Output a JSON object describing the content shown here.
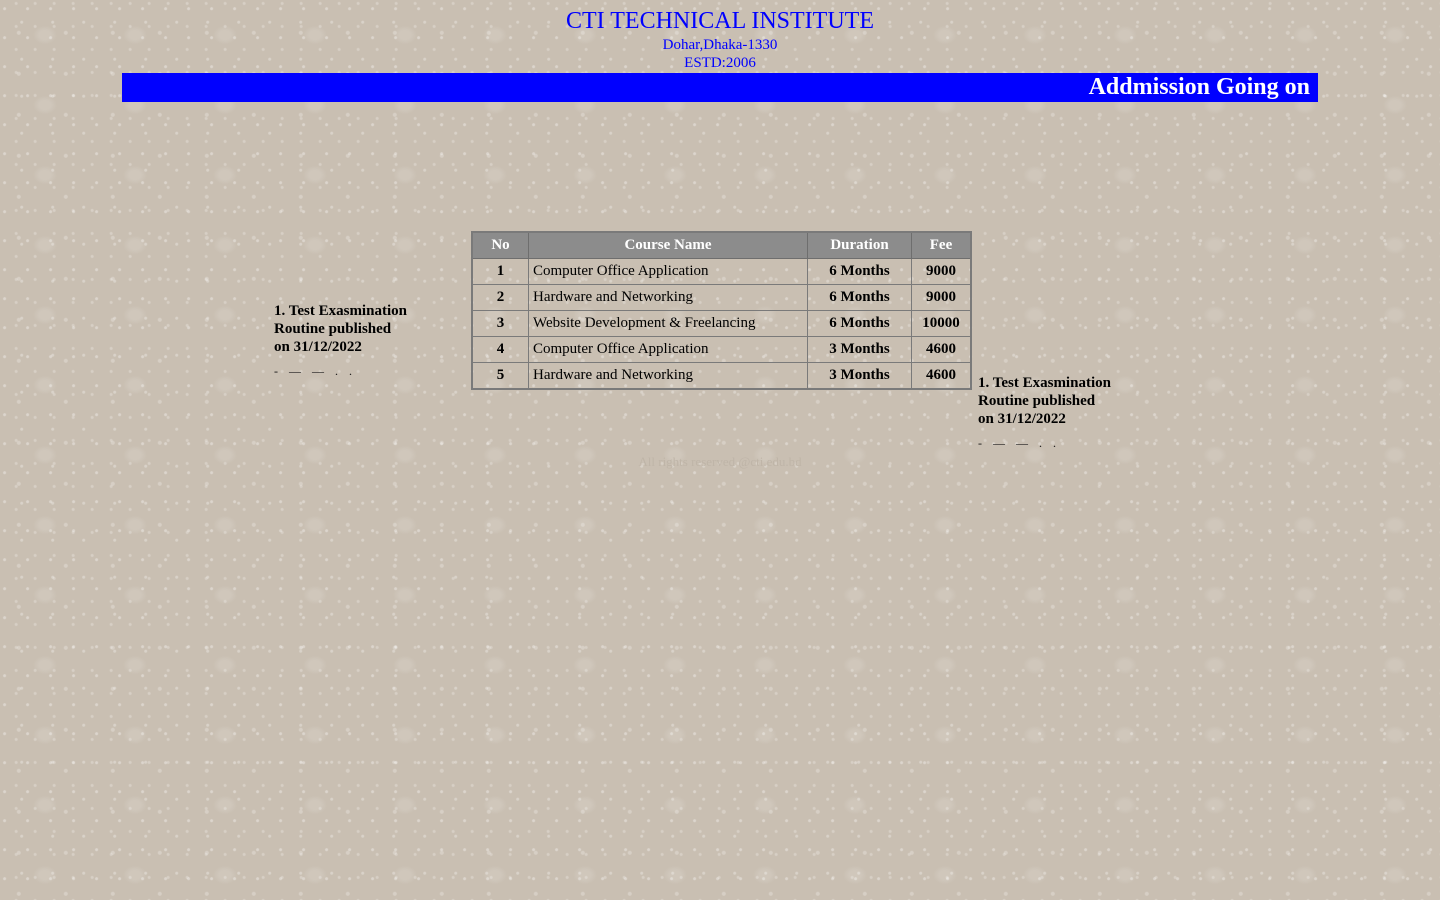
{
  "header": {
    "title": "CTI TECHNICAL INSTITUTE",
    "address": "Dohar,Dhaka-1330",
    "established": "ESTD:2006"
  },
  "marquee": {
    "text": "Addmission Going on",
    "background_color": "#0000ff",
    "text_color": "#ffffff"
  },
  "notices": {
    "left": {
      "line1": "1. Test Exasmination",
      "line2": "Routine published",
      "line3": "on 31/12/2022",
      "dashes": "- — — . ."
    },
    "right": {
      "line1": "1. Test Exasmination",
      "line2": "Routine published",
      "line3": "on 31/12/2022",
      "dashes": "- — — . ."
    }
  },
  "courses": {
    "headers": {
      "no": "No",
      "name": "Course Name",
      "duration": "Duration",
      "fee": "Fee"
    },
    "rows": [
      {
        "no": "1",
        "name": "Computer Office Application",
        "duration": "6 Months",
        "fee": "9000"
      },
      {
        "no": "2",
        "name": "Hardware and Networking",
        "duration": "6 Months",
        "fee": "9000"
      },
      {
        "no": "3",
        "name": "Website Development & Freelancing",
        "duration": "6 Months",
        "fee": "10000"
      },
      {
        "no": "4",
        "name": "Computer Office Application",
        "duration": "3 Months",
        "fee": "4600"
      },
      {
        "no": "5",
        "name": "Hardware and Networking",
        "duration": "3 Months",
        "fee": "4600"
      }
    ]
  },
  "footer": {
    "text": "All rights reserved @cti.edu.bd"
  },
  "colors": {
    "brand_blue": "#0000ff",
    "table_header_bg": "#8c8c8c"
  }
}
